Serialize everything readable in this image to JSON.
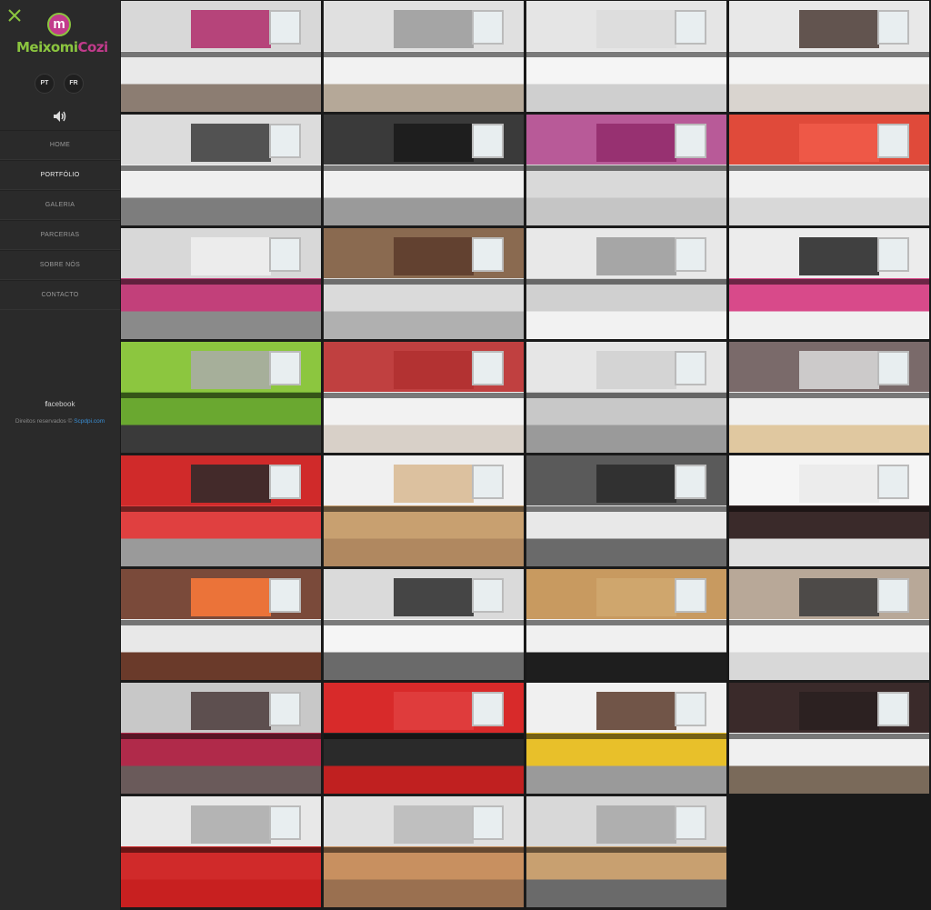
{
  "brand": {
    "part1": "Meixomi",
    "part2": "Cozi"
  },
  "logo_letter": "m",
  "languages": [
    "PT",
    "FR"
  ],
  "nav": [
    "HOME",
    "PORTFÓLIO",
    "GALERIA",
    "PARCERIAS",
    "SOBRE NÓS",
    "CONTACTO"
  ],
  "active_nav": "PORTFÓLIO",
  "social": {
    "prefix": "f",
    "label": "acebook"
  },
  "footer": {
    "text": "Direitos reservados © ",
    "link": "Scpdpi.com"
  },
  "icons": {
    "close": "close-icon",
    "sound": "speaker-icon"
  },
  "colors": {
    "accent_green": "#8bc53f",
    "accent_magenta": "#c23b8c",
    "link": "#3a8fd6"
  },
  "gallery": [
    {
      "c1": "#d8d8d8",
      "c2": "#e9e9e9",
      "c3": "#8c7d72",
      "acc": "#b02a6a"
    },
    {
      "c1": "#e0e0e0",
      "c2": "#f2f2f2",
      "c3": "#b5a898",
      "acc": "#9a9a9a"
    },
    {
      "c1": "#e5e5e5",
      "c2": "#f5f5f5",
      "c3": "#cfcfcf",
      "acc": "#dcdcdc"
    },
    {
      "c1": "#e8e8e8",
      "c2": "#f3f3f3",
      "c3": "#d9d4cf",
      "acc": "#4a3a34"
    },
    {
      "c1": "#dcdcdc",
      "c2": "#efefef",
      "c3": "#7d7d7d",
      "acc": "#3a3a3a"
    },
    {
      "c1": "#3a3a3a",
      "c2": "#f0f0f0",
      "c3": "#9a9a9a",
      "acc": "#1a1a1a"
    },
    {
      "c1": "#b85a98",
      "c2": "#d9d9d9",
      "c3": "#c5c5c5",
      "acc": "#902a6a"
    },
    {
      "c1": "#e04a3a",
      "c2": "#f0f0f0",
      "c3": "#d8d8d8",
      "acc": "#f05a4a"
    },
    {
      "c1": "#d8d8d8",
      "c2": "#c2407a",
      "c3": "#8a8a8a",
      "acc": "#f0f0f0"
    },
    {
      "c1": "#8a6a50",
      "c2": "#dadada",
      "c3": "#b0b0b0",
      "acc": "#5a3a2a"
    },
    {
      "c1": "#e8e8e8",
      "c2": "#d0d0d0",
      "c3": "#f2f2f2",
      "acc": "#9a9a9a"
    },
    {
      "c1": "#ececec",
      "c2": "#d84a8a",
      "c3": "#f0f0f0",
      "acc": "#222"
    },
    {
      "c1": "#8cc63f",
      "c2": "#6aa830",
      "c3": "#3a3a3a",
      "acc": "#aaa"
    },
    {
      "c1": "#c04040",
      "c2": "#f2f2f2",
      "c3": "#d8d0c8",
      "acc": "#b03030"
    },
    {
      "c1": "#e6e6e6",
      "c2": "#c8c8c8",
      "c3": "#9a9a9a",
      "acc": "#d0d0d0"
    },
    {
      "c1": "#7a6a6a",
      "c2": "#f0f0f0",
      "c3": "#e0c8a0",
      "acc": "#dadada"
    },
    {
      "c1": "#d02a2a",
      "c2": "#e04040",
      "c3": "#9a9a9a",
      "acc": "#2a2a2a"
    },
    {
      "c1": "#f0f0f0",
      "c2": "#c8a070",
      "c3": "#b08860",
      "acc": "#d8b890"
    },
    {
      "c1": "#5a5a5a",
      "c2": "#e8e8e8",
      "c3": "#6a6a6a",
      "acc": "#2a2a2a"
    },
    {
      "c1": "#f5f5f5",
      "c2": "#3a2a2a",
      "c3": "#e0e0e0",
      "acc": "#eaeaea"
    },
    {
      "c1": "#7a4a3a",
      "c2": "#e8e8e8",
      "c3": "#6a3a2a",
      "acc": "#ff7a3a"
    },
    {
      "c1": "#dadada",
      "c2": "#f5f5f5",
      "c3": "#6a6a6a",
      "acc": "#2a2a2a"
    },
    {
      "c1": "#c89a60",
      "c2": "#f0f0f0",
      "c3": "#1e1e1e",
      "acc": "#d0a870"
    },
    {
      "c1": "#b8a898",
      "c2": "#f2f2f2",
      "c3": "#d8d8d8",
      "acc": "#3a3a3a"
    },
    {
      "c1": "#c8c8c8",
      "c2": "#b02a4a",
      "c3": "#6a5a5a",
      "acc": "#4a3a3a"
    },
    {
      "c1": "#d82a2a",
      "c2": "#2a2a2a",
      "c3": "#c02020",
      "acc": "#e04040"
    },
    {
      "c1": "#f0f0f0",
      "c2": "#e8c02a",
      "c3": "#9a9a9a",
      "acc": "#5a3a2a"
    },
    {
      "c1": "#3a2a2a",
      "c2": "#f0f0f0",
      "c3": "#7a6a5a",
      "acc": "#2a2020"
    },
    {
      "c1": "#e8e8e8",
      "c2": "#d02a2a",
      "c3": "#c82020",
      "acc": "#aaa"
    },
    {
      "c1": "#e0e0e0",
      "c2": "#c89060",
      "c3": "#9a7050",
      "acc": "#b8b8b8"
    },
    {
      "c1": "#d8d8d8",
      "c2": "#c8a070",
      "c3": "#6a6a6a",
      "acc": "#a8a8a8"
    }
  ]
}
